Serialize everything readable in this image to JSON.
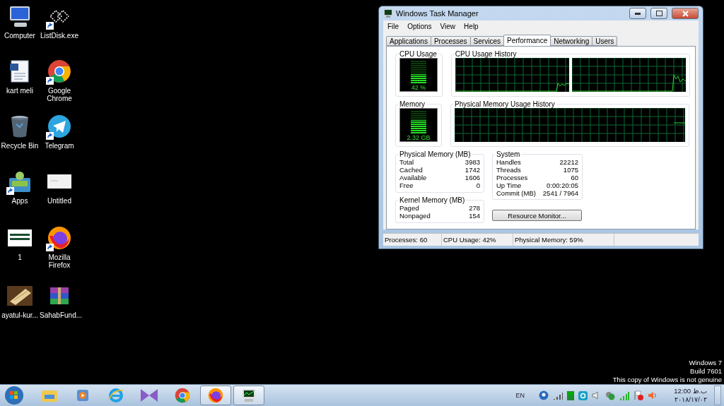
{
  "desktop_icons": [
    {
      "label": "Computer",
      "kind": "computer",
      "shortcut": false
    },
    {
      "label": "ListDisk.exe",
      "kind": "listdisk",
      "shortcut": true
    },
    {
      "label": "kart meli",
      "kind": "document",
      "shortcut": false
    },
    {
      "label": "Google Chrome",
      "kind": "chrome",
      "shortcut": true
    },
    {
      "label": "Recycle Bin",
      "kind": "recycle",
      "shortcut": false
    },
    {
      "label": "Telegram",
      "kind": "telegram",
      "shortcut": true
    },
    {
      "label": "Apps",
      "kind": "apps",
      "shortcut": true
    },
    {
      "label": "Untitled",
      "kind": "blank",
      "shortcut": false
    },
    {
      "label": "1",
      "kind": "screenshot",
      "shortcut": false
    },
    {
      "label": "Mozilla Firefox",
      "kind": "firefox",
      "shortcut": true
    },
    {
      "label": "ayatul-kur...",
      "shortcut": false
    },
    {
      "label": "SahabFund...",
      "kind": "archive",
      "shortcut": false
    }
  ],
  "task_manager": {
    "title": "Windows Task Manager",
    "menu": [
      "File",
      "Options",
      "View",
      "Help"
    ],
    "tabs": [
      {
        "label": "Applications",
        "selected": false
      },
      {
        "label": "Processes",
        "selected": false
      },
      {
        "label": "Services",
        "selected": false
      },
      {
        "label": "Performance",
        "selected": true
      },
      {
        "label": "Networking",
        "selected": false
      },
      {
        "label": "Users",
        "selected": false
      }
    ],
    "cpu_usage": {
      "label": "CPU Usage",
      "reading": "42 %",
      "level": 0.42
    },
    "cpu_history": {
      "label": "CPU Usage History"
    },
    "memory": {
      "label": "Memory",
      "reading": "2.32 GB",
      "level": 0.59
    },
    "memory_history": {
      "label": "Physical Memory Usage History"
    },
    "physical_memory": {
      "title": "Physical Memory (MB)",
      "rows": [
        {
          "label": "Total",
          "value": "3983"
        },
        {
          "label": "Cached",
          "value": "1742"
        },
        {
          "label": "Available",
          "value": "1606"
        },
        {
          "label": "Free",
          "value": "0"
        }
      ]
    },
    "kernel_memory": {
      "title": "Kernel Memory (MB)",
      "rows": [
        {
          "label": "Paged",
          "value": "278"
        },
        {
          "label": "Nonpaged",
          "value": "154"
        }
      ]
    },
    "system": {
      "title": "System",
      "rows": [
        {
          "label": "Handles",
          "value": "22212"
        },
        {
          "label": "Threads",
          "value": "1075"
        },
        {
          "label": "Processes",
          "value": "60"
        },
        {
          "label": "Up Time",
          "value": "0:00:20:05"
        },
        {
          "label": "Commit (MB)",
          "value": "2541 / 7964"
        }
      ]
    },
    "resource_button": "Resource Monitor...",
    "status_bar": [
      "Processes: 60",
      "CPU Usage: 42%",
      "Physical Memory: 59%"
    ]
  },
  "os_notice": [
    "Windows 7",
    "Build 7601",
    "This copy of Windows is not genuine"
  ],
  "taskbar": {
    "items": [
      {
        "kind": "explorer",
        "running": false
      },
      {
        "kind": "media",
        "running": false
      },
      {
        "kind": "ie",
        "running": false
      },
      {
        "kind": "vs",
        "running": false
      },
      {
        "kind": "chrome",
        "running": false
      },
      {
        "kind": "firefox",
        "running": true
      },
      {
        "kind": "taskmanager",
        "running": true
      }
    ],
    "language": "EN",
    "time": "12:00 ب.ظ",
    "date": "۲۰۱۸/۱۷/۰۲"
  }
}
